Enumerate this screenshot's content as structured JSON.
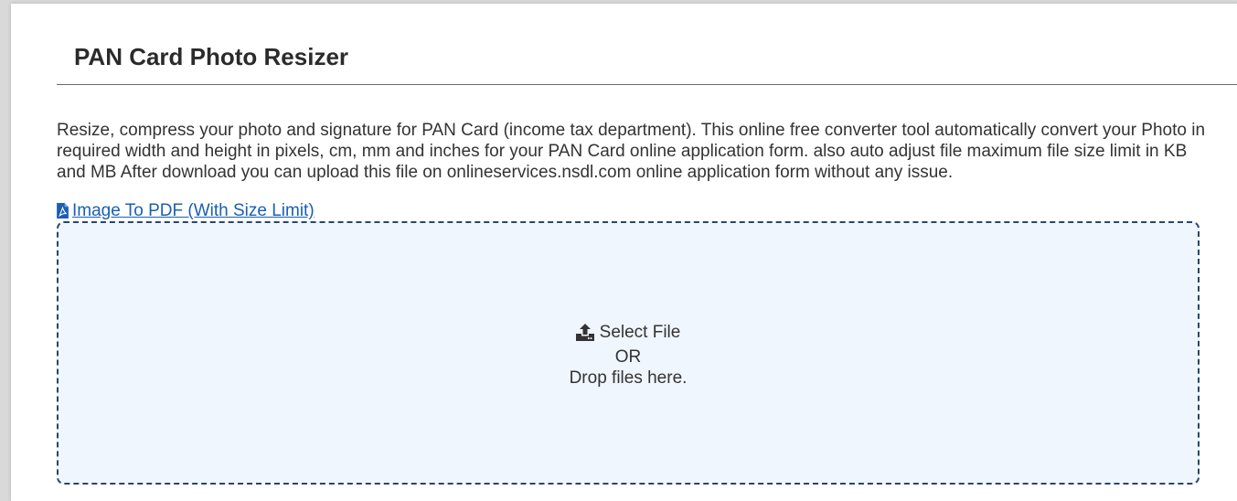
{
  "header": {
    "title": "PAN Card Photo Resizer"
  },
  "main": {
    "description": "Resize, compress your photo and signature for PAN Card (income tax department). This online free converter tool automatically convert your Photo in required width and height in pixels, cm, mm and inches for your PAN Card online application form. also auto adjust file maximum file size limit in KB and MB After download you can upload this file on onlineservices.nsdl.com online application form without any issue.",
    "pdf_link": {
      "label": "Image To PDF (With Size Limit)",
      "icon": "file-pdf-icon"
    },
    "dropzone": {
      "select_label": "Select File",
      "or_label": "OR",
      "drop_label": "Drop files here.",
      "icon": "upload-icon"
    }
  },
  "colors": {
    "link": "#1a5fb4",
    "dropzone_bg": "#f0f6fd",
    "dropzone_border": "#27466e",
    "text": "#333333"
  }
}
